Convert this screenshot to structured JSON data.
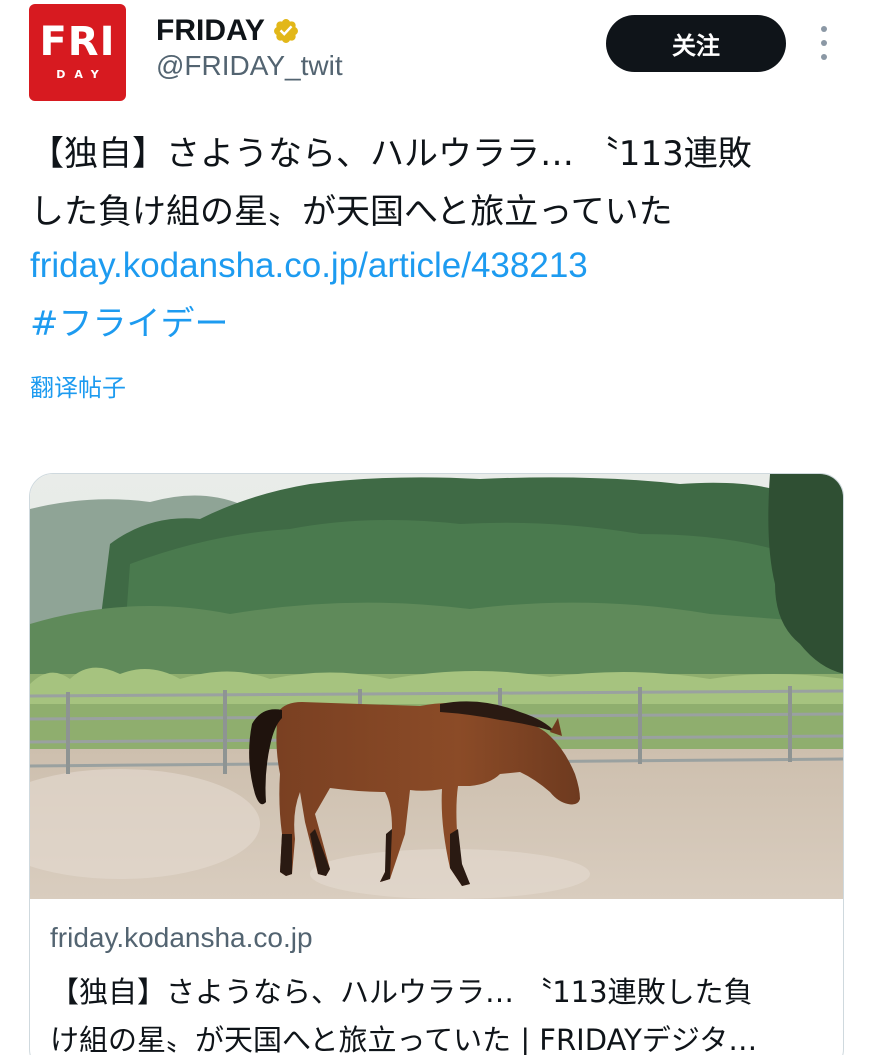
{
  "account": {
    "avatar_logo": "FRI",
    "avatar_logo_sub": "DAY",
    "display_name": "FRIDAY",
    "handle": "@FRIDAY_twit",
    "verified_icon": "verified-badge-icon",
    "verified_color": "#e2b719"
  },
  "header": {
    "follow_label": "关注",
    "more_icon": "more-vertical-icon"
  },
  "post": {
    "text_lines": [
      "【独自】さようなら、ハルウララ… 〝113連敗",
      "した負け組の星〟が天国へと旅立っていた"
    ],
    "link": "friday.kodansha.co.jp/article/438213",
    "hashtag": "#フライデー",
    "translate_label": "翻译帖子"
  },
  "card": {
    "image_subject": "brown horse walking in a dusty paddock with forest behind",
    "domain": "friday.kodansha.co.jp",
    "title_lines": [
      "【独自】さようなら、ハルウララ… 〝113連敗した負",
      "け組の星〟が天国へと旅立っていた | FRIDAYデジタ…"
    ]
  },
  "colors": {
    "link": "#1d9bf0",
    "text": "#0f1419",
    "secondary": "#536471",
    "brand_red": "#d71a20",
    "button_bg": "#0f1419"
  }
}
